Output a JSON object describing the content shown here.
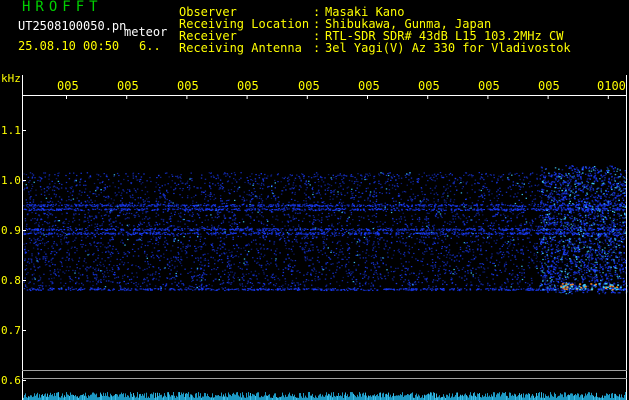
{
  "header": {
    "app_name": "HROFFT",
    "filename": "UT2508100050.pn",
    "event_type": "meteor",
    "datetime": "25.08.10 00:50",
    "count": "6..",
    "info": [
      {
        "label": "Observer",
        "value": "Masaki Kano"
      },
      {
        "label": "Receiving Location",
        "value": "Shibukawa, Gunma, Japan"
      },
      {
        "label": "Receiver",
        "value": "RTL-SDR SDR# 43dB L15 103.2MHz CW"
      },
      {
        "label": "Receiving Antenna",
        "value": "3el Yagi(V) Az 330 for Vladivostok"
      }
    ]
  },
  "axis": {
    "unit": "kHz",
    "time_labels": [
      "005",
      "005",
      "005",
      "005",
      "005",
      "005",
      "005",
      "005",
      "005",
      "0100"
    ],
    "freq_ticks": [
      "1.1",
      "1.0",
      "0.9",
      "0.8",
      "0.7",
      "0.6"
    ]
  },
  "colors": {
    "label_yellow": "#ffff00",
    "title_green": "#00d000",
    "signal_blue": "#1a3cff",
    "signal_cyan": "#40d0ff",
    "signal_orange": "#ff8a20",
    "axis_white": "#ffffff"
  }
}
